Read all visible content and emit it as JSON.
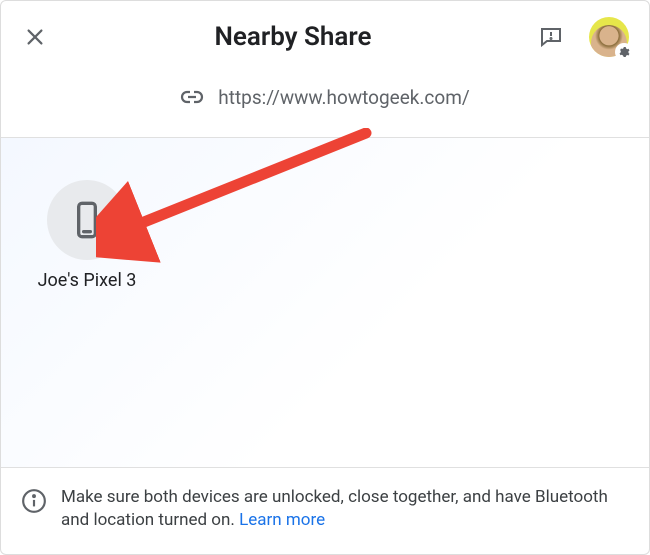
{
  "header": {
    "title": "Nearby Share"
  },
  "share": {
    "url": "https://www.howtogeek.com/"
  },
  "devices": [
    {
      "label": "Joe's Pixel 3"
    }
  ],
  "footer": {
    "message": "Make sure both devices are unlocked, close together, and have Bluetooth and location turned on.",
    "learn_more": "Learn more"
  },
  "colors": {
    "accent": "#1a73e8",
    "arrow": "#ed4335"
  }
}
